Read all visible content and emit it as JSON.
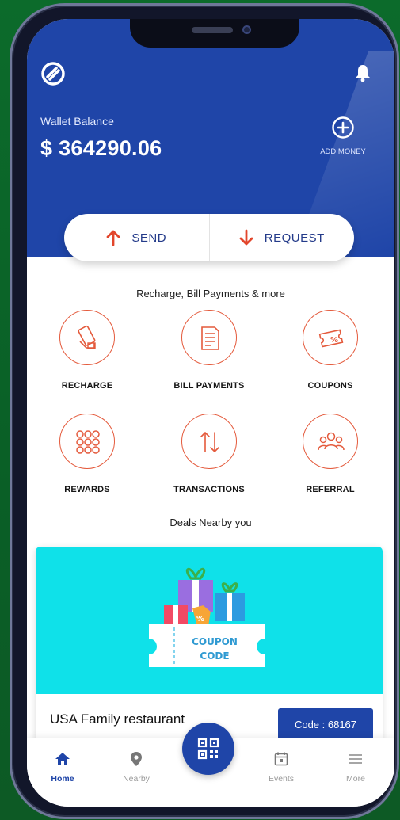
{
  "header": {
    "wallet_label": "Wallet Balance",
    "balance": "$ 364290.06",
    "add_money_label": "ADD MONEY"
  },
  "actions": {
    "send_label": "SEND",
    "request_label": "REQUEST"
  },
  "services_title": "Recharge, Bill Payments & more",
  "services": [
    {
      "label": "RECHARGE",
      "icon": "mobile-recharge-icon"
    },
    {
      "label": "BILL PAYMENTS",
      "icon": "bill-icon"
    },
    {
      "label": "COUPONS",
      "icon": "coupon-icon"
    },
    {
      "label": "REWARDS",
      "icon": "rewards-grid-icon"
    },
    {
      "label": "TRANSACTIONS",
      "icon": "transactions-icon"
    },
    {
      "label": "REFERRAL",
      "icon": "referral-icon"
    }
  ],
  "deals_title": "Deals Nearby you",
  "deal": {
    "banner_line1": "COUPON",
    "banner_line2": "CODE",
    "name": "USA Family restaurant",
    "code": "Code : 68167"
  },
  "nav": [
    {
      "label": "Home",
      "icon": "home-icon",
      "active": true
    },
    {
      "label": "Nearby",
      "icon": "location-pin-icon"
    },
    {
      "label": "Events",
      "icon": "calendar-icon"
    },
    {
      "label": "More",
      "icon": "menu-icon"
    }
  ],
  "colors": {
    "brand_blue": "#1f45a8",
    "accent_red": "#e45a3c",
    "banner_cyan": "#0fe1e9",
    "background_green": "#0e6a2c"
  }
}
